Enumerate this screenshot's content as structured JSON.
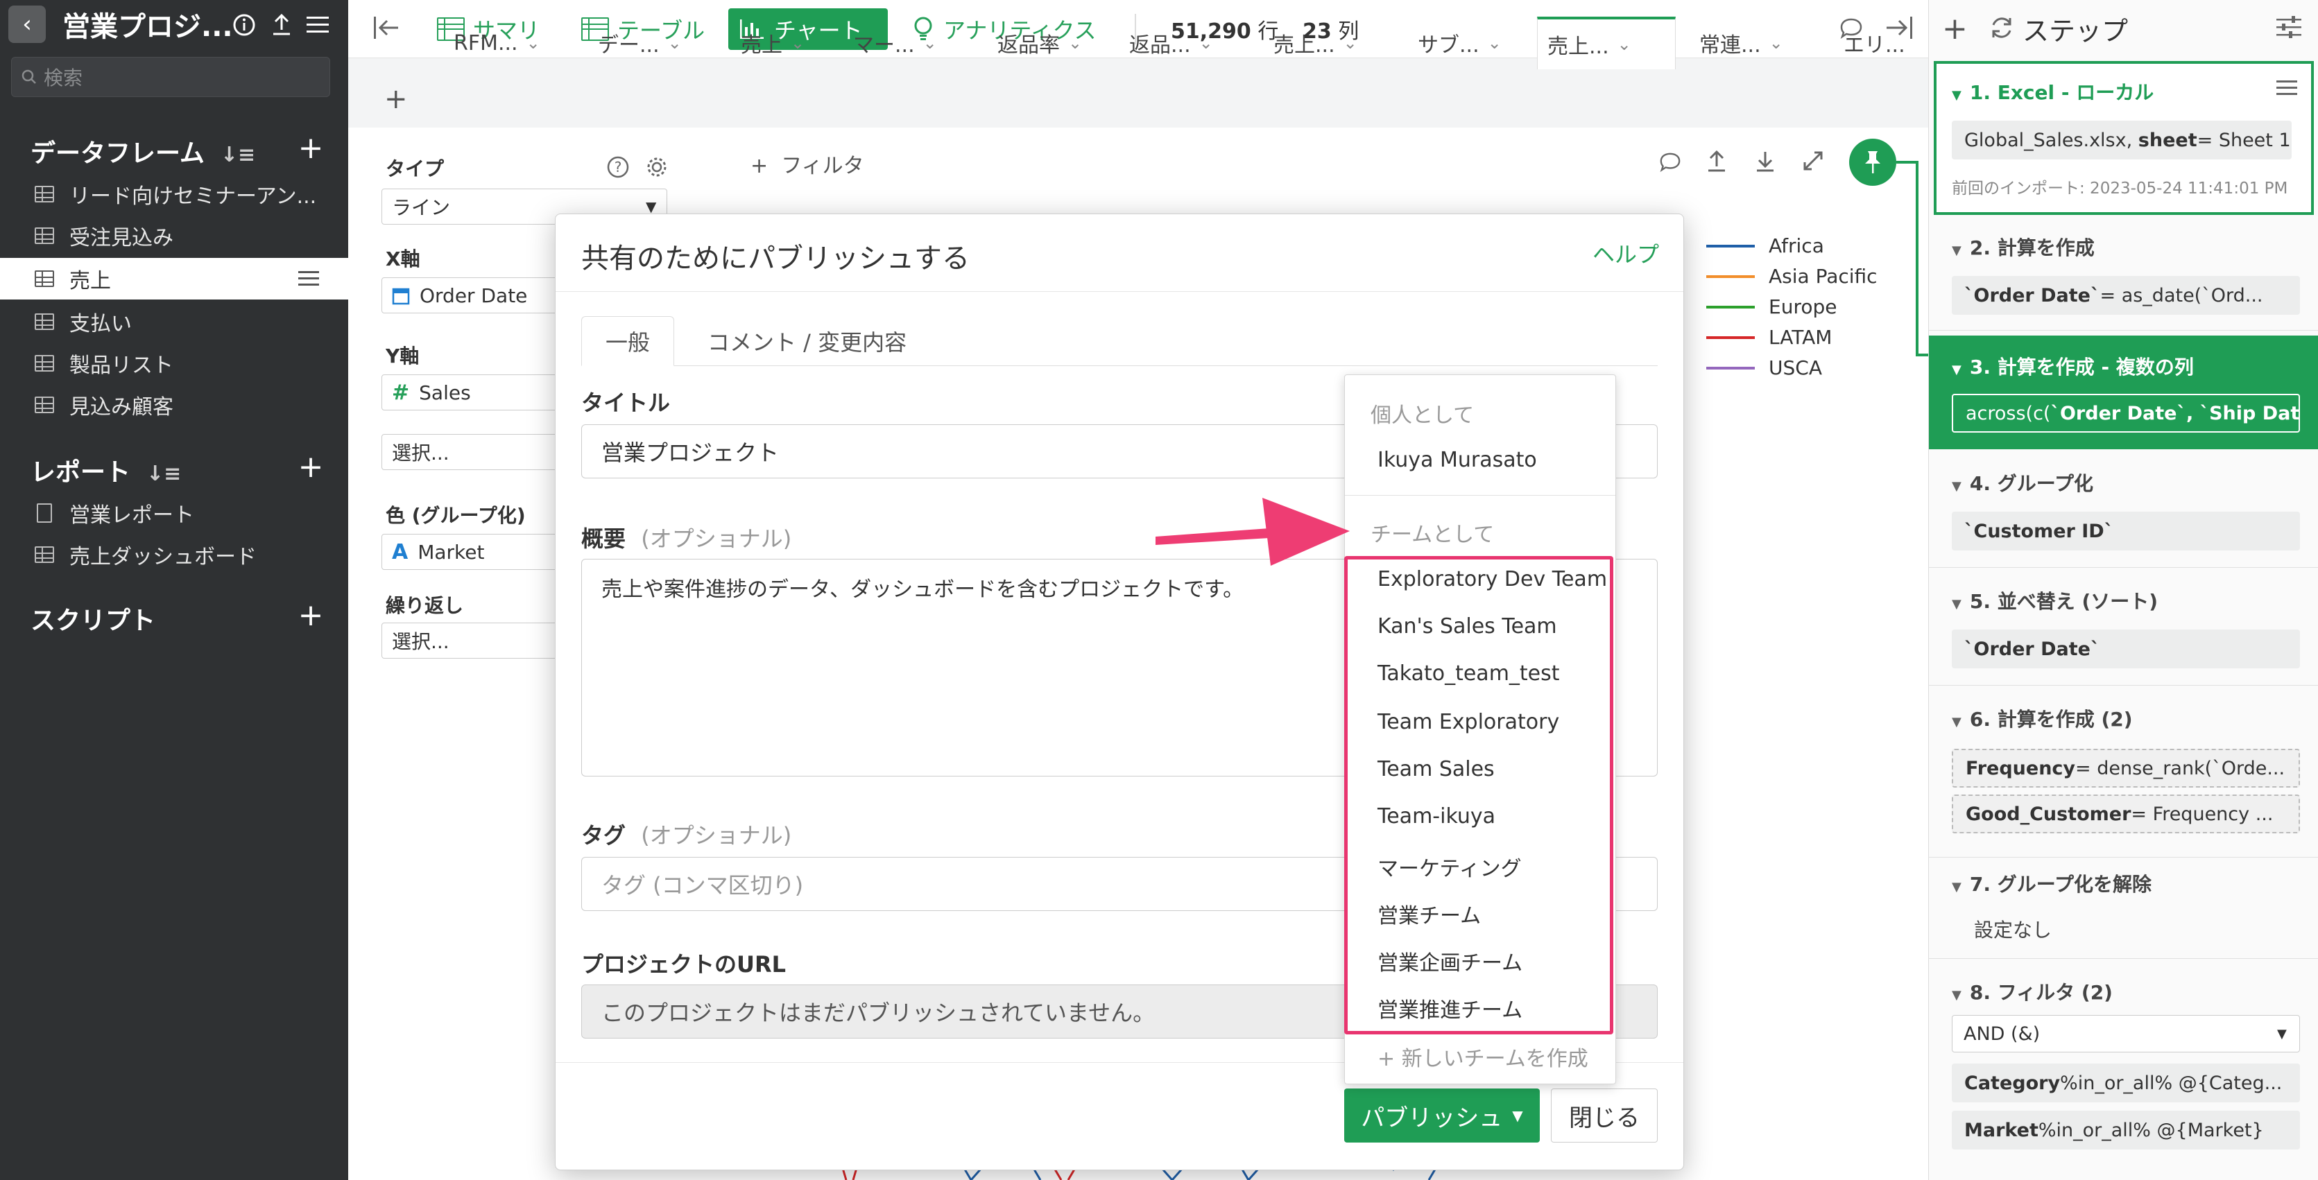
{
  "project": {
    "title": "営業プロジ..."
  },
  "sidebar": {
    "search_placeholder": "検索",
    "dataframes_header": "データフレーム",
    "dataframes": [
      {
        "label": "リード向けセミナーアン..."
      },
      {
        "label": "受注見込み"
      },
      {
        "label": "売上"
      },
      {
        "label": "支払い"
      },
      {
        "label": "製品リスト"
      },
      {
        "label": "見込み顧客"
      }
    ],
    "reports_header": "レポート",
    "reports": [
      {
        "label": "営業レポート"
      },
      {
        "label": "売上ダッシュボード"
      }
    ],
    "scripts_header": "スクリプト"
  },
  "toolbar": {
    "summary": "サマリ",
    "table": "テーブル",
    "chart": "チャート",
    "analytics": "アナリティクス",
    "rows": "51,290",
    "rows_unit": "行",
    "cols": "23",
    "cols_unit": "列"
  },
  "tabs": [
    "RFM...",
    "デー...",
    "売上",
    "マー...",
    "返品率",
    "返品...",
    "売上...",
    "サブ...",
    "売上...",
    "常連...",
    "エリ..."
  ],
  "active_tab_index": 8,
  "chart_settings": {
    "type_label": "タイプ",
    "type_value": "ライン",
    "x_label": "X軸",
    "x_value": "Order Date",
    "y_label": "Y軸",
    "y_value": "Sales",
    "y_select": "選択...",
    "color_label": "色 (グループ化)",
    "color_value": "Market",
    "repeat_label": "繰り返し",
    "repeat_value": "選択...",
    "filter": "フィルタ"
  },
  "legend": [
    {
      "name": "Africa",
      "color": "#1f5fa8"
    },
    {
      "name": "Asia Pacific",
      "color": "#f28e2b"
    },
    {
      "name": "Europe",
      "color": "#2ca02c"
    },
    {
      "name": "LATAM",
      "color": "#d62728"
    },
    {
      "name": "USCA",
      "color": "#9467bd"
    }
  ],
  "modal": {
    "title": "共有のためにパブリッシュする",
    "help": "ヘルプ",
    "tab_general": "一般",
    "tab_comment": "コメント / 変更内容",
    "title_label": "タイトル",
    "title_value": "営業プロジェクト",
    "summary_label": "概要",
    "optional": "(オプショナル)",
    "summary_value": "売上や案件進捗のデータ、ダッシュボードを含むプロジェクトです。",
    "tag_label": "タグ",
    "tag_placeholder": "タグ (コンマ区切り)",
    "url_label": "プロジェクトのURL",
    "url_value": "このプロジェクトはまだパブリッシュされていません。",
    "publish_button": "パブリッシュ",
    "close_button": "閉じる"
  },
  "dropdown": {
    "personal_header": "個人として",
    "personal_user": "Ikuya Murasato",
    "team_header": "チームとして",
    "teams": [
      "Exploratory Dev Team",
      "Kan's Sales Team",
      "Takato_team_test",
      "Team Exploratory",
      "Team Sales",
      "Team-ikuya",
      "マーケティング",
      "営業チーム",
      "営業企画チーム",
      "営業推進チーム"
    ],
    "new_team": "+ 新しいチームを作成"
  },
  "steps": {
    "header": "ステップ",
    "items": [
      {
        "title": "1. Excel - ローカル",
        "chip_html_plain": "Global_Sales.xlsx,",
        "chip_bold": "sheet",
        "chip_rest": " = Sheet 1",
        "note": "前回のインポート: 2023-05-24 11:41:01 PM"
      },
      {
        "title": "2. 計算を作成",
        "chip_bold": "`Order Date`",
        "chip_rest": " = as_date(`Ord..."
      },
      {
        "title": "3. 計算を作成 - 複数の列",
        "chip_plain": "across(c(",
        "chip_bold": "`Order Date`, `Ship Date`",
        "chip_rest": "),..."
      },
      {
        "title": "4. グループ化",
        "chip_bold": "`Customer ID`"
      },
      {
        "title": "5. 並べ替え (ソート)",
        "chip_bold": "`Order Date`"
      },
      {
        "title": "6. 計算を作成 (2)",
        "chip1_bold": "Frequency",
        "chip1_rest": " = dense_rank(`Orde...",
        "chip2_bold": "Good_Customer",
        "chip2_rest": " = Frequency ..."
      },
      {
        "title": "7. グループ化を解除",
        "text": "設定なし"
      },
      {
        "title": "8. フィルタ (2)",
        "select": "AND (&)",
        "chip1_bold": "Category",
        "chip1_rest": " %in_or_all% @{Categ...",
        "chip2_bold": "Market",
        "chip2_rest": " %in_or_all% @{Market}"
      }
    ]
  },
  "colors": {
    "accent": "#1f9d55",
    "sidebar_bg": "#2f3133",
    "highlight": "#e8356f",
    "arrow": "#ee3d73"
  }
}
